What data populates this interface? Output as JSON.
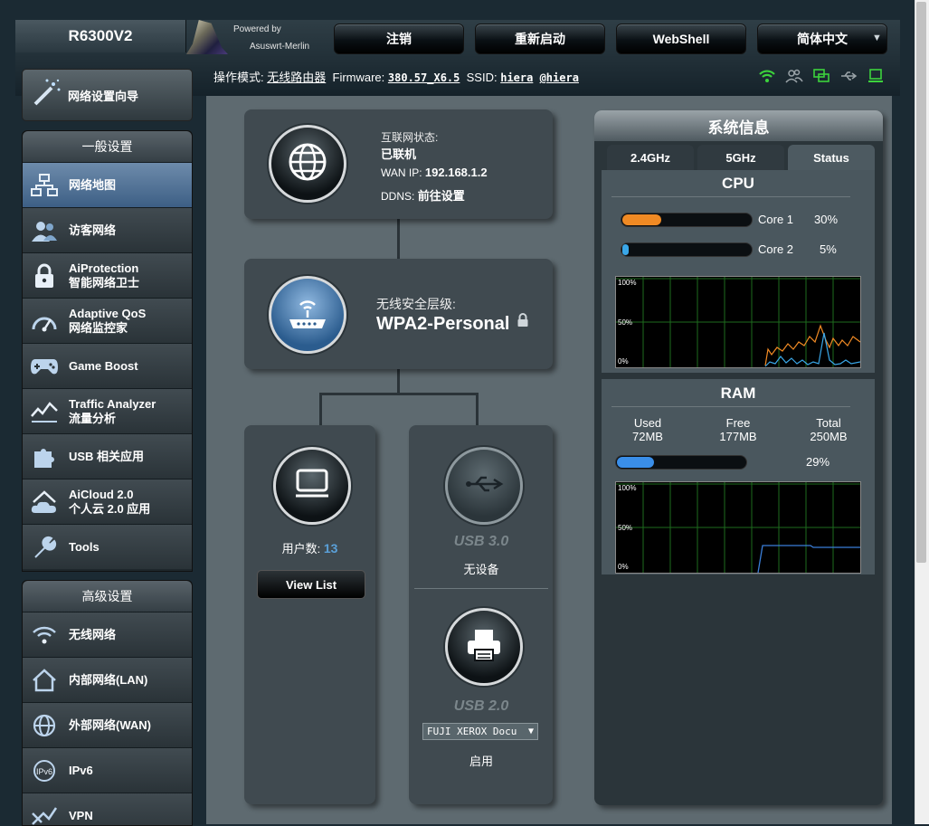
{
  "header": {
    "model": "R6300V2",
    "powered_by": "Powered by",
    "firmware_brand": "Asuswrt-Merlin",
    "buttons": [
      "注销",
      "重新启动",
      "WebShell",
      "简体中文"
    ]
  },
  "infoline": {
    "mode_label": "操作模式:",
    "mode_value": "无线路由器",
    "firmware_label": "Firmware:",
    "firmware_value": "380.57_X6.5",
    "ssid_label": "SSID:",
    "ssid_1": "hiera",
    "ssid_2": "@hiera"
  },
  "menu": {
    "wizard": "网络设置向导",
    "general_title": "一般设置",
    "general_items": [
      {
        "line1": "网络地图",
        "line2": ""
      },
      {
        "line1": "访客网络",
        "line2": ""
      },
      {
        "line1": "AiProtection",
        "line2": "智能网络卫士"
      },
      {
        "line1": "Adaptive QoS",
        "line2": "网络监控家"
      },
      {
        "line1": "Game Boost",
        "line2": ""
      },
      {
        "line1": "Traffic Analyzer",
        "line2": "流量分析"
      },
      {
        "line1": "USB 相关应用",
        "line2": ""
      },
      {
        "line1": "AiCloud 2.0",
        "line2": "个人云 2.0 应用"
      },
      {
        "line1": "Tools",
        "line2": ""
      }
    ],
    "advanced_title": "高级设置",
    "advanced_items": [
      {
        "line1": "无线网络"
      },
      {
        "line1": "内部网络(LAN)"
      },
      {
        "line1": "外部网络(WAN)"
      },
      {
        "line1": "IPv6"
      },
      {
        "line1": "VPN"
      }
    ]
  },
  "internet": {
    "status_label": "互联网状态:",
    "status_value": "已联机",
    "wan_ip_label": "WAN IP:",
    "wan_ip": "192.168.1.2",
    "ddns_label": "DDNS:",
    "ddns_value": "前往设置"
  },
  "wireless": {
    "security_label": "无线安全层级:",
    "security_value": "WPA2-Personal"
  },
  "clients": {
    "label": "用户数:",
    "count": "13",
    "button": "View List"
  },
  "usb3": {
    "title": "USB 3.0",
    "status": "无设备"
  },
  "usb2": {
    "title": "USB 2.0",
    "device": "FUJI XEROX Docu",
    "status": "启用"
  },
  "sysinfo": {
    "title": "系统信息",
    "tabs": [
      "2.4GHz",
      "5GHz",
      "Status"
    ],
    "cpu_title": "CPU",
    "cores": [
      {
        "name": "Core 1",
        "percent": "30%",
        "value": 30,
        "color": "#f08a24"
      },
      {
        "name": "Core 2",
        "percent": "5%",
        "value": 5,
        "color": "#3aa7e8"
      }
    ],
    "ram_title": "RAM",
    "ram": {
      "used_label": "Used",
      "used": "72MB",
      "free_label": "Free",
      "free": "177MB",
      "total_label": "Total",
      "total": "250MB",
      "percent": "29%",
      "value": 29
    },
    "graph_labels": [
      "100%",
      "50%",
      "0%"
    ]
  },
  "colors": {
    "accent_orange": "#f08a24",
    "accent_blue": "#3aa7e8",
    "wifi_green": "#3cd23c"
  }
}
